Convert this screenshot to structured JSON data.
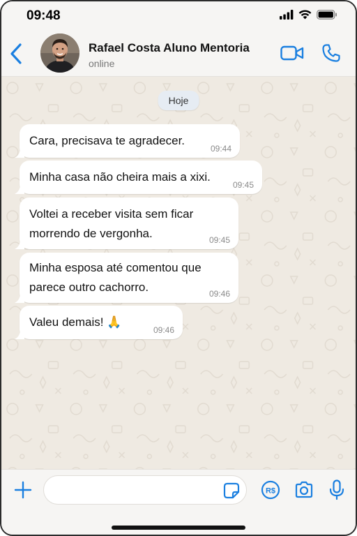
{
  "status_bar": {
    "time": "09:48",
    "icons": [
      "signal-bars-icon",
      "wifi-icon",
      "battery-icon"
    ]
  },
  "header": {
    "back_icon": "chevron-left-icon",
    "contact_name": "Rafael Costa Aluno Mentoria",
    "contact_status": "online",
    "actions": [
      "video-call-icon",
      "phone-icon"
    ]
  },
  "chat": {
    "date_label": "Hoje",
    "messages": [
      {
        "lines": [
          "Cara, precisava te agradecer."
        ],
        "time": "09:44"
      },
      {
        "lines": [
          "Minha casa não cheira mais a xixi."
        ],
        "time": "09:45"
      },
      {
        "lines": [
          "Voltei a receber visita sem ficar",
          "morrendo de vergonha."
        ],
        "time": "09:45"
      },
      {
        "lines": [
          "Minha esposa até comentou que",
          "parece outro cachorro."
        ],
        "time": "09:46"
      },
      {
        "lines": [
          "Valeu demais! 🙏"
        ],
        "time": "09:46"
      }
    ]
  },
  "composer": {
    "input_value": "",
    "icons": [
      "plus-icon",
      "sticker-icon",
      "pix-icon",
      "camera-icon",
      "microphone-icon"
    ],
    "pix_label": "R$"
  },
  "colors": {
    "accent": "#1a7fe0",
    "chat_background": "#efeae2",
    "bubble": "#ffffff",
    "header_background": "#f6f5f3"
  }
}
